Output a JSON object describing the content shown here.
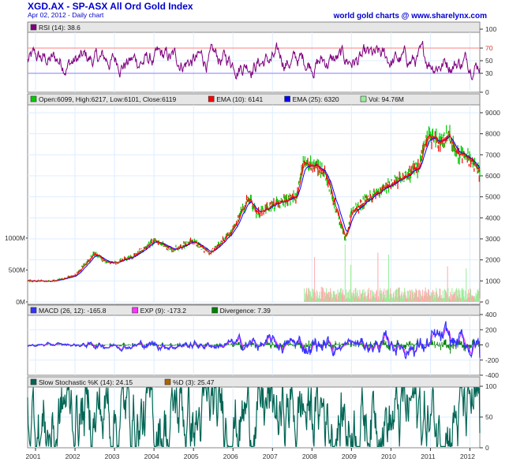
{
  "header": {
    "title": "XGD.AX - SP-ASX All Ord Gold Index",
    "subtitle": "Apr 02, 2012 - Daily chart",
    "credit": "world gold charts @ www.sharelynx.com"
  },
  "colors": {
    "title": "#0000cc",
    "rsi": "#800080",
    "price_up": "#00cc00",
    "price_down": "#ff0000",
    "ema10": "#ff0000",
    "ema25": "#0000ff",
    "volume": "#99ee99",
    "macd": "#3333ff",
    "exp": "#ff33ff",
    "divergence": "#008000",
    "stoch": "#006655",
    "band_hi": "#ff9999",
    "band_lo": "#9999ff",
    "grid": "#ddeeff"
  },
  "chart_data": [
    {
      "type": "line",
      "panel": "rsi",
      "legend": [
        {
          "label": "RSI (14): 38.6",
          "color": "#800080"
        }
      ],
      "yticks": [
        "100",
        "70",
        "50",
        "30",
        "0"
      ],
      "ylim": [
        0,
        100
      ],
      "bands": [
        70,
        30
      ],
      "last": 38.6,
      "range_approx": [
        20,
        85
      ]
    },
    {
      "type": "line",
      "panel": "price",
      "legend": [
        {
          "label": "Open:6099, High:6217, Low:6101, Close:6119",
          "color": "#00cc00"
        },
        {
          "label": "EMA (10): 6141",
          "color": "#ff0000"
        },
        {
          "label": "EMA (25): 6320",
          "color": "#0000ff"
        },
        {
          "label": "Vol: 94.76M",
          "color": "#99ee99"
        }
      ],
      "yticks": [
        "9000",
        "8000",
        "7000",
        "6000",
        "5000",
        "4000",
        "3000",
        "2000",
        "1000",
        "0"
      ],
      "ylim": [
        0,
        9500
      ],
      "volume_ticks": [
        "1000M",
        "500M",
        "0M"
      ],
      "x": [
        2000.8,
        2001.5,
        2002.0,
        2002.5,
        2002.8,
        2003.0,
        2003.5,
        2004.0,
        2004.5,
        2005.0,
        2005.4,
        2006.0,
        2006.4,
        2006.6,
        2007.0,
        2007.6,
        2007.8,
        2008.0,
        2008.3,
        2008.6,
        2008.85,
        2009.0,
        2009.5,
        2010.0,
        2010.4,
        2010.7,
        2010.95,
        2011.2,
        2011.5,
        2011.7,
        2012.0,
        2012.25
      ],
      "close": [
        1000,
        1000,
        1250,
        2300,
        1900,
        1850,
        2200,
        2900,
        2500,
        2900,
        2300,
        3400,
        5000,
        4200,
        4600,
        5000,
        6700,
        6500,
        6300,
        4500,
        2900,
        4300,
        5000,
        5600,
        6000,
        6400,
        7900,
        7600,
        7900,
        7000,
        6800,
        6119
      ],
      "volume_start": 2007.8,
      "volume_typical_M": 120,
      "volume_peak_M": 900
    },
    {
      "type": "line",
      "panel": "macd",
      "legend": [
        {
          "label": "MACD (26, 12): -165.8",
          "color": "#3333ff"
        },
        {
          "label": "EXP (9): -173.2",
          "color": "#ff33ff"
        },
        {
          "label": "Divergence: 7.39",
          "color": "#008000"
        }
      ],
      "yticks": [
        "400",
        "200",
        "0",
        "-200",
        "-400"
      ],
      "ylim": [
        -400,
        400
      ]
    },
    {
      "type": "line",
      "panel": "stochastic",
      "legend": [
        {
          "label": "Slow Stochastic %K (14): 24.15",
          "color": "#006655"
        },
        {
          "label": "%D (3): 25.47",
          "color": "#aa6600"
        }
      ],
      "yticks": [
        "100",
        "50",
        "0"
      ],
      "ylim": [
        0,
        100
      ]
    },
    {
      "type": "axis",
      "panel": "x",
      "xticks": [
        "2001",
        "2002",
        "2003",
        "2004",
        "2005",
        "2006",
        "2007",
        "2008",
        "2009",
        "2010",
        "2011",
        "2012"
      ]
    }
  ]
}
